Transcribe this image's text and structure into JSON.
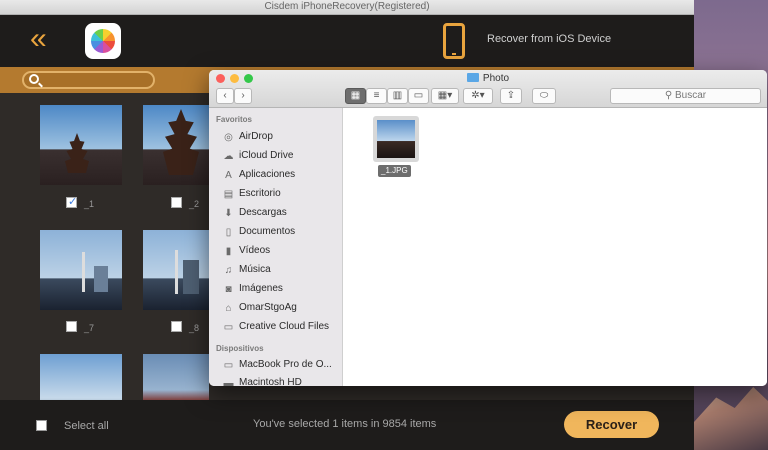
{
  "app": {
    "title": "Cisdem iPhoneRecovery(Registered)",
    "back_icon": "double-chevron-left-icon",
    "device_label": "Recover from iOS Device",
    "accent": "#e9a43e"
  },
  "grid": {
    "items": [
      {
        "label": "_1",
        "checked": true
      },
      {
        "label": "_2",
        "checked": false
      },
      {
        "label": "_7",
        "checked": false
      },
      {
        "label": "_8",
        "checked": false
      }
    ]
  },
  "footer": {
    "select_all": "Select all",
    "selected_info": "You've selected 1 items in 9854 items",
    "recover": "Recover"
  },
  "finder": {
    "title": "Photo",
    "search_placeholder": "Buscar",
    "favorites_header": "Favoritos",
    "devices_header": "Dispositivos",
    "favorites": [
      {
        "label": "AirDrop",
        "icon": "airdrop-icon"
      },
      {
        "label": "iCloud Drive",
        "icon": "cloud-icon"
      },
      {
        "label": "Aplicaciones",
        "icon": "applications-icon"
      },
      {
        "label": "Escritorio",
        "icon": "desktop-icon"
      },
      {
        "label": "Descargas",
        "icon": "download-icon"
      },
      {
        "label": "Documentos",
        "icon": "document-icon"
      },
      {
        "label": "Vídeos",
        "icon": "film-icon"
      },
      {
        "label": "Música",
        "icon": "music-icon"
      },
      {
        "label": "Imágenes",
        "icon": "camera-icon"
      },
      {
        "label": "OmarStgoAg",
        "icon": "home-icon"
      },
      {
        "label": "Creative Cloud Files",
        "icon": "folder-icon"
      }
    ],
    "devices": [
      {
        "label": "MacBook Pro de O...",
        "icon": "laptop-icon"
      },
      {
        "label": "Macintosh HD",
        "icon": "disk-icon"
      }
    ],
    "file": {
      "name": "_1.JPG"
    }
  }
}
